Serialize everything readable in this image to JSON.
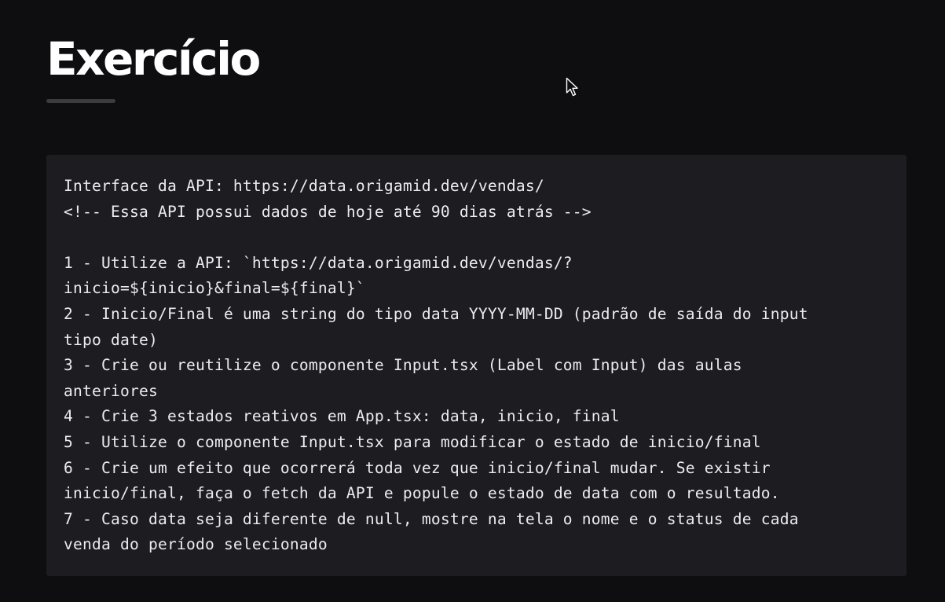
{
  "header": {
    "title": "Exercício"
  },
  "exercise": {
    "lines": [
      "Interface da API: https://data.origamid.dev/vendas/",
      "<!-- Essa API possui dados de hoje até 90 dias atrás -->",
      "",
      "1 - Utilize a API: `https://data.origamid.dev/vendas/?",
      "inicio=${inicio}&final=${final}`",
      "2 - Inicio/Final é uma string do tipo data YYYY-MM-DD (padrão de saída do input",
      "tipo date)",
      "3 - Crie ou reutilize o componente Input.tsx (Label com Input) das aulas",
      "anteriores",
      "4 - Crie 3 estados reativos em App.tsx: data, inicio, final",
      "5 - Utilize o componente Input.tsx para modificar o estado de inicio/final",
      "6 - Crie um efeito que ocorrerá toda vez que inicio/final mudar. Se existir",
      "inicio/final, faça o fetch da API e popule o estado de data com o resultado.",
      "7 - Caso data seja diferente de null, mostre na tela o nome e o status de cada",
      "venda do período selecionado"
    ]
  },
  "icons": {
    "cursor": "mouse-pointer-arrow-icon"
  },
  "colors": {
    "background": "#0e0d10",
    "code_background": "#1d1c20",
    "title": "#ffffff",
    "text": "#ecebf0",
    "underline": "#3c3b40"
  }
}
